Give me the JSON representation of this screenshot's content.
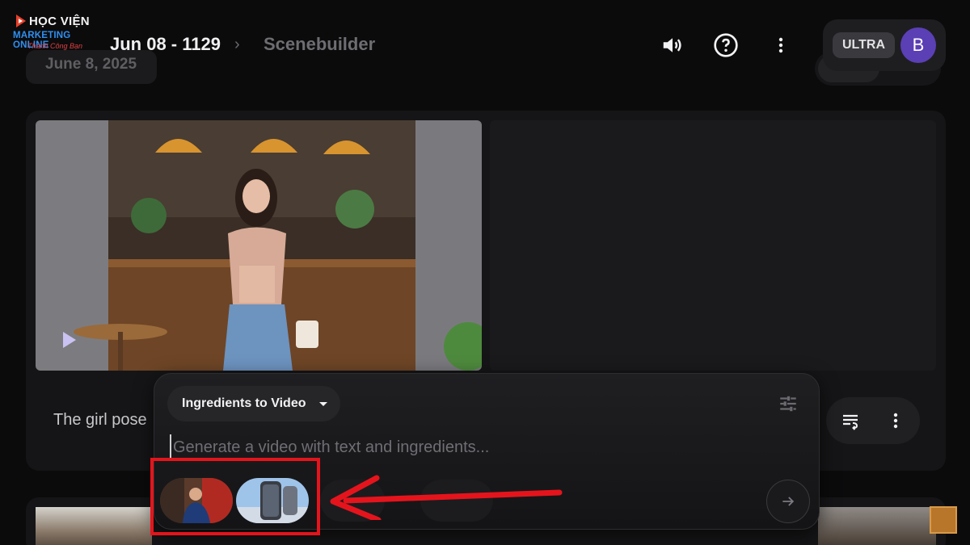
{
  "header": {
    "logo": {
      "line1": "HỌC VIỆN",
      "line2": "MARKETING ONLINE",
      "line3": "Thành Công Bạn"
    },
    "date_chip": "June 8, 2025",
    "breadcrumb": {
      "project": "Jun 08 - 1129",
      "separator": "›",
      "page": "Scenebuilder"
    },
    "icons": [
      "volume-icon",
      "help-icon",
      "more-vert-icon"
    ],
    "plan_badge": "ULTRA",
    "avatar_initial": "B"
  },
  "scene": {
    "caption": "The girl pose",
    "actions": [
      "queue-icon",
      "more-vert-icon"
    ]
  },
  "composer": {
    "mode": "Ingredients to Video",
    "prompt_placeholder": "Generate a video with text and ingredients...",
    "prompt_value": "",
    "ingredients": [
      "person-photo",
      "phone-photo"
    ],
    "send_icon": "arrow-right-icon"
  },
  "colors": {
    "background": "#0b0b0c",
    "card": "#151517",
    "avatar": "#5b3fb5",
    "annotation": "#e5141c",
    "accent_blue": "#2f8ff0"
  }
}
